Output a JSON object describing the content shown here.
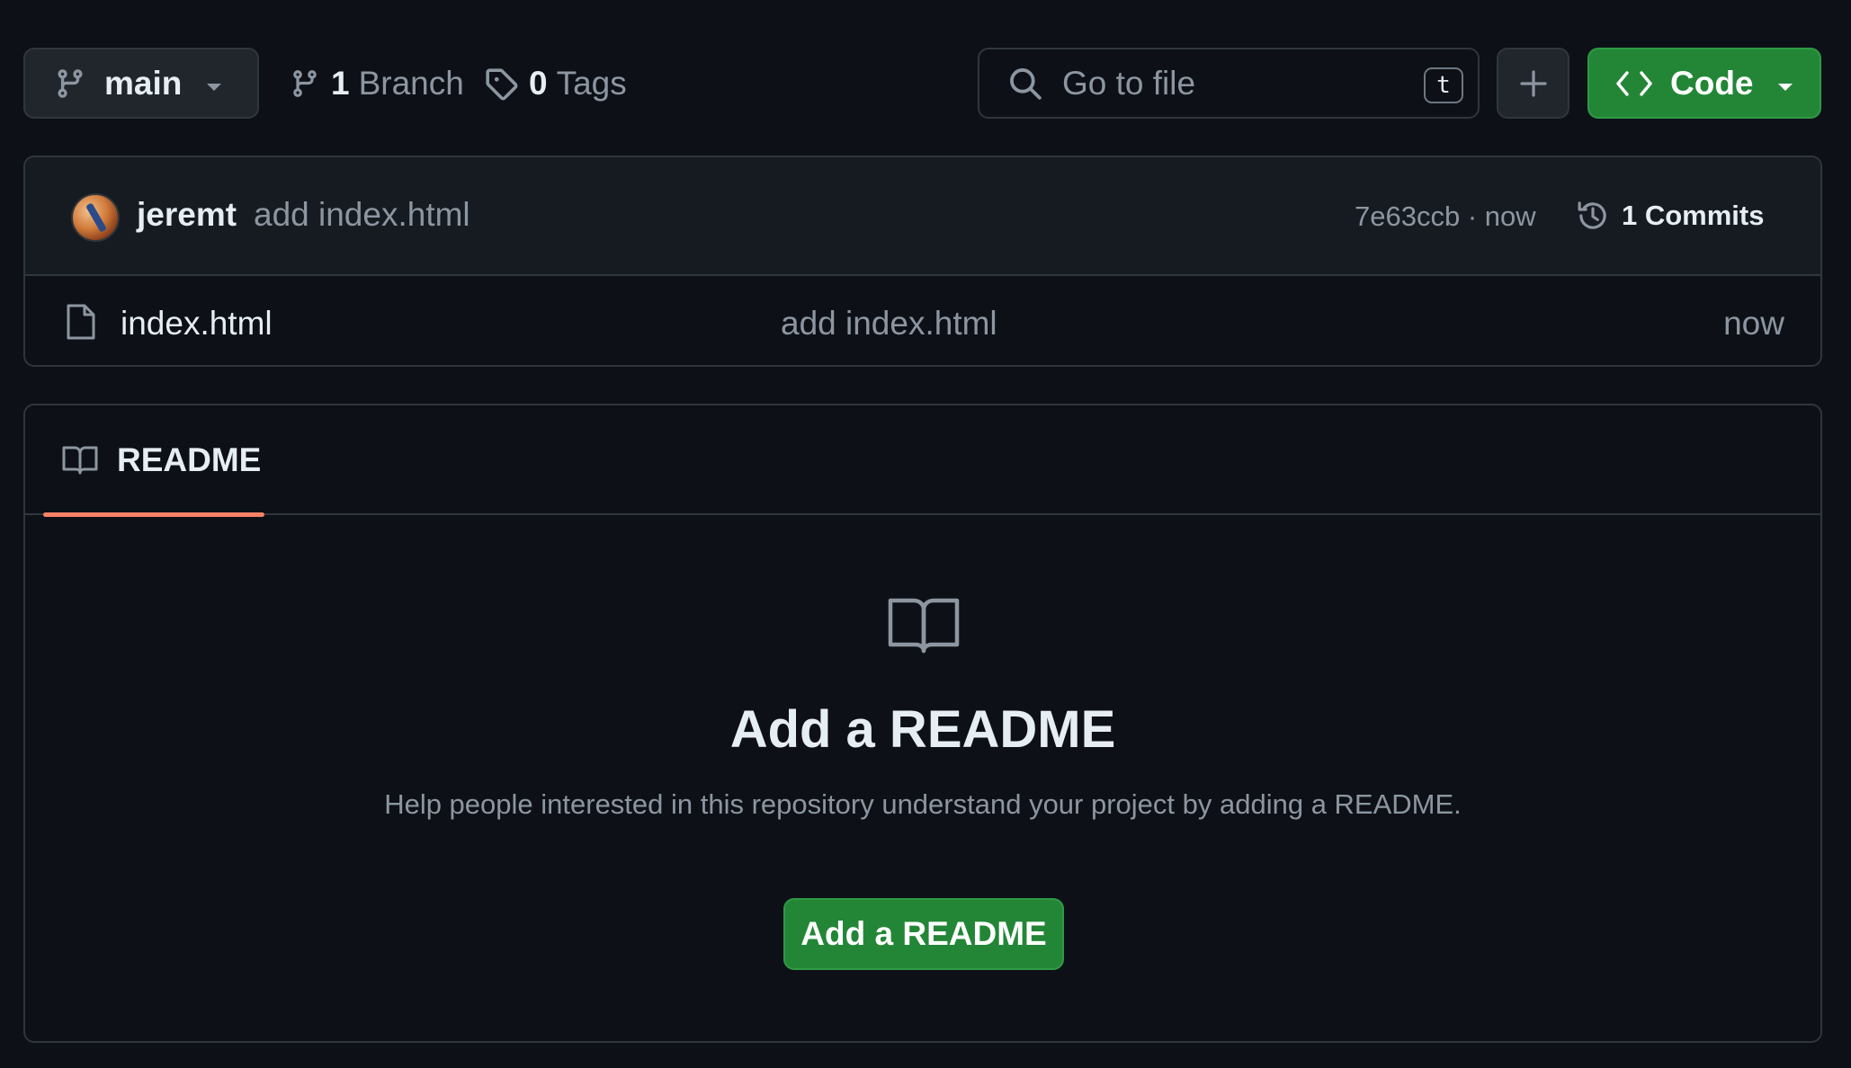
{
  "toolbar": {
    "branch_name": "main",
    "branches_count": "1",
    "branches_label": "Branch",
    "tags_count": "0",
    "tags_label": "Tags",
    "search_placeholder": "Go to file",
    "search_shortcut": "t",
    "code_label": "Code"
  },
  "latest_commit": {
    "author": "jeremt",
    "message": "add index.html",
    "sha_time": "7e63ccb · now",
    "commits_label": "1 Commits"
  },
  "files": [
    {
      "name": "index.html",
      "commit_message": "add index.html",
      "age": "now"
    }
  ],
  "readme": {
    "tab_label": "README",
    "empty_title": "Add a README",
    "empty_description": "Help people interested in this repository understand your project by adding a README.",
    "add_button_label": "Add a README"
  },
  "colors": {
    "background": "#0d1117",
    "border": "#30363d",
    "primary_button": "#238636",
    "tab_underline": "#f78166",
    "muted_text": "#8d96a0"
  }
}
